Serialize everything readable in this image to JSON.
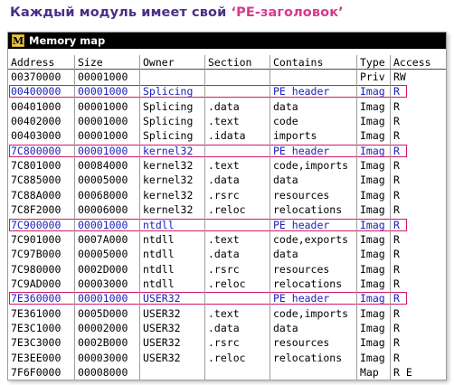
{
  "heading": {
    "prefix": "Каждый модуль имеет свой ",
    "highlight": "‘PE-заголовок’"
  },
  "window": {
    "icon_letter": "M",
    "title": "Memory map"
  },
  "columns": [
    "Address",
    "Size",
    "Owner",
    "Section",
    "Contains",
    "Type",
    "Access"
  ],
  "rows": [
    {
      "address": "00370000",
      "size": "00001000",
      "owner": "",
      "section": "",
      "contains": "",
      "type": "Priv",
      "access": "RW",
      "hl": false
    },
    {
      "address": "00400000",
      "size": "00001000",
      "owner": "Splicing",
      "section": "",
      "contains": "PE header",
      "type": "Imag",
      "access": "R",
      "hl": true
    },
    {
      "address": "00401000",
      "size": "00001000",
      "owner": "Splicing",
      "section": ".data",
      "contains": "data",
      "type": "Imag",
      "access": "R",
      "hl": false
    },
    {
      "address": "00402000",
      "size": "00001000",
      "owner": "Splicing",
      "section": ".text",
      "contains": "code",
      "type": "Imag",
      "access": "R",
      "hl": false
    },
    {
      "address": "00403000",
      "size": "00001000",
      "owner": "Splicing",
      "section": ".idata",
      "contains": "imports",
      "type": "Imag",
      "access": "R",
      "hl": false
    },
    {
      "address": "7C800000",
      "size": "00001000",
      "owner": "kernel32",
      "section": "",
      "contains": "PE header",
      "type": "Imag",
      "access": "R",
      "hl": true
    },
    {
      "address": "7C801000",
      "size": "00084000",
      "owner": "kernel32",
      "section": ".text",
      "contains": "code,imports",
      "type": "Imag",
      "access": "R",
      "hl": false
    },
    {
      "address": "7C885000",
      "size": "00005000",
      "owner": "kernel32",
      "section": ".data",
      "contains": "data",
      "type": "Imag",
      "access": "R",
      "hl": false
    },
    {
      "address": "7C88A000",
      "size": "00068000",
      "owner": "kernel32",
      "section": ".rsrc",
      "contains": "resources",
      "type": "Imag",
      "access": "R",
      "hl": false
    },
    {
      "address": "7C8F2000",
      "size": "00006000",
      "owner": "kernel32",
      "section": ".reloc",
      "contains": "relocations",
      "type": "Imag",
      "access": "R",
      "hl": false
    },
    {
      "address": "7C900000",
      "size": "00001000",
      "owner": "ntdll",
      "section": "",
      "contains": "PE header",
      "type": "Imag",
      "access": "R",
      "hl": true
    },
    {
      "address": "7C901000",
      "size": "0007A000",
      "owner": "ntdll",
      "section": ".text",
      "contains": "code,exports",
      "type": "Imag",
      "access": "R",
      "hl": false
    },
    {
      "address": "7C97B000",
      "size": "00005000",
      "owner": "ntdll",
      "section": ".data",
      "contains": "data",
      "type": "Imag",
      "access": "R",
      "hl": false
    },
    {
      "address": "7C980000",
      "size": "0002D000",
      "owner": "ntdll",
      "section": ".rsrc",
      "contains": "resources",
      "type": "Imag",
      "access": "R",
      "hl": false
    },
    {
      "address": "7C9AD000",
      "size": "00003000",
      "owner": "ntdll",
      "section": ".reloc",
      "contains": "relocations",
      "type": "Imag",
      "access": "R",
      "hl": false
    },
    {
      "address": "7E360000",
      "size": "00001000",
      "owner": "USER32",
      "section": "",
      "contains": "PE header",
      "type": "Imag",
      "access": "R",
      "hl": true
    },
    {
      "address": "7E361000",
      "size": "0005D000",
      "owner": "USER32",
      "section": ".text",
      "contains": "code,imports",
      "type": "Imag",
      "access": "R",
      "hl": false
    },
    {
      "address": "7E3C1000",
      "size": "00002000",
      "owner": "USER32",
      "section": ".data",
      "contains": "data",
      "type": "Imag",
      "access": "R",
      "hl": false
    },
    {
      "address": "7E3C3000",
      "size": "0002B000",
      "owner": "USER32",
      "section": ".rsrc",
      "contains": "resources",
      "type": "Imag",
      "access": "R",
      "hl": false
    },
    {
      "address": "7E3EE000",
      "size": "00003000",
      "owner": "USER32",
      "section": ".reloc",
      "contains": "relocations",
      "type": "Imag",
      "access": "R",
      "hl": false
    },
    {
      "address": "7F6F0000",
      "size": "00008000",
      "owner": "",
      "section": "",
      "contains": "",
      "type": "Map",
      "access": "R E",
      "hl": false
    }
  ]
}
